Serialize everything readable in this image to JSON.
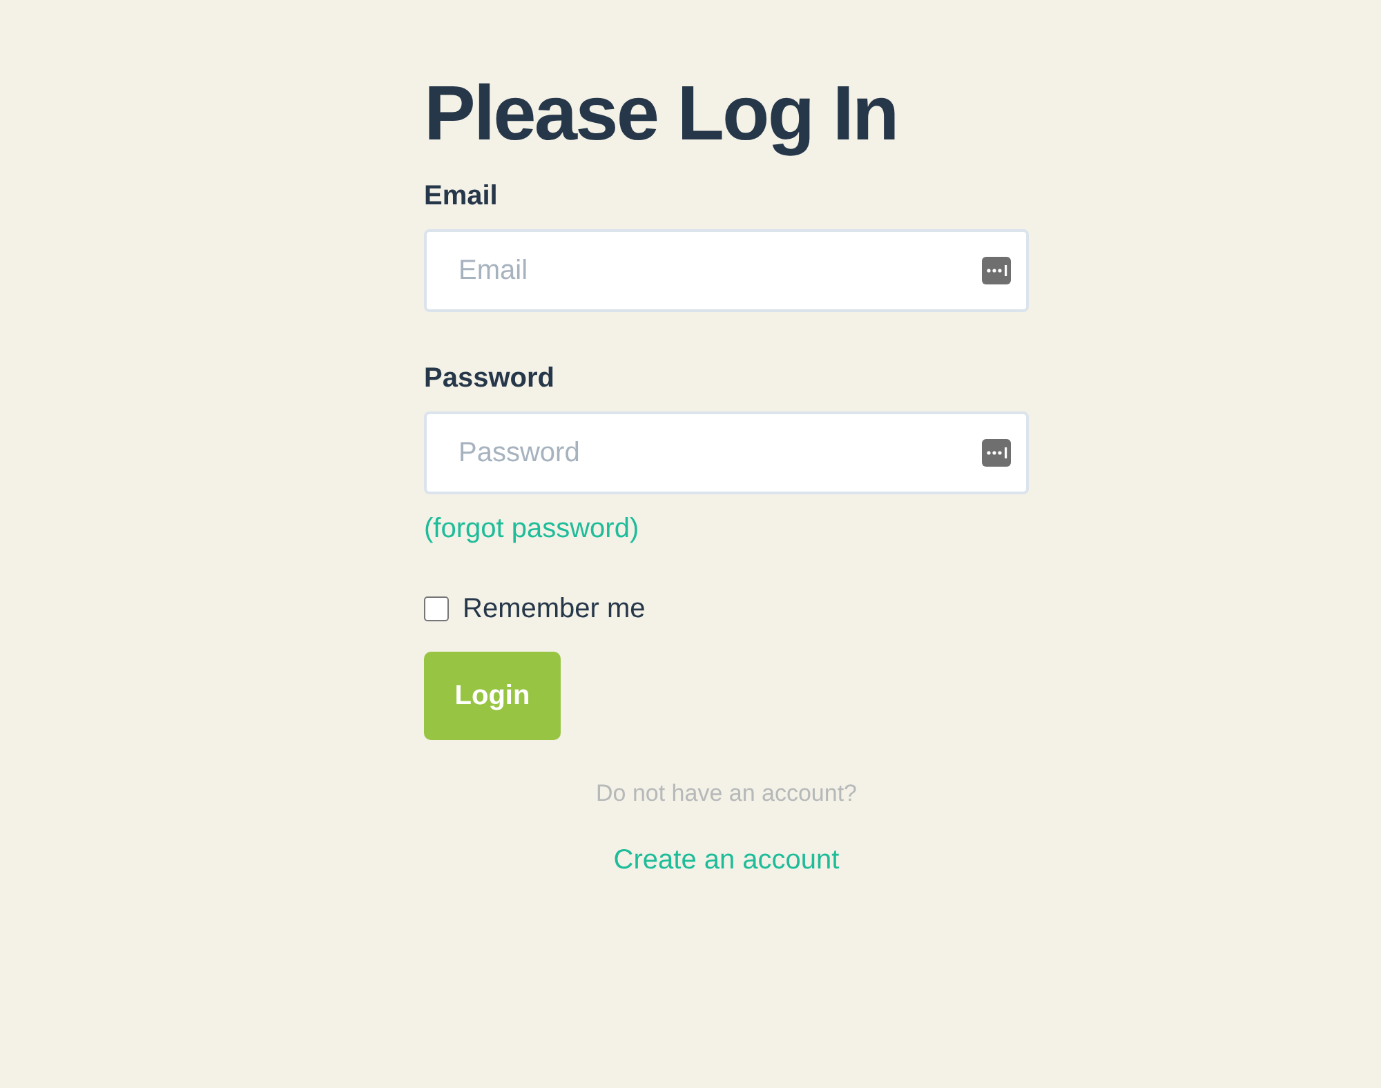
{
  "title": "Please Log In",
  "fields": [
    {
      "label": "Email",
      "placeholder": "Email"
    },
    {
      "label": "Password",
      "placeholder": "Password"
    }
  ],
  "forgot_link": "(forgot password)",
  "remember": {
    "label": "Remember me",
    "checked": false
  },
  "login_button": "Login",
  "signup_prompt": "Do not have an account?",
  "signup_link": "Create an account"
}
